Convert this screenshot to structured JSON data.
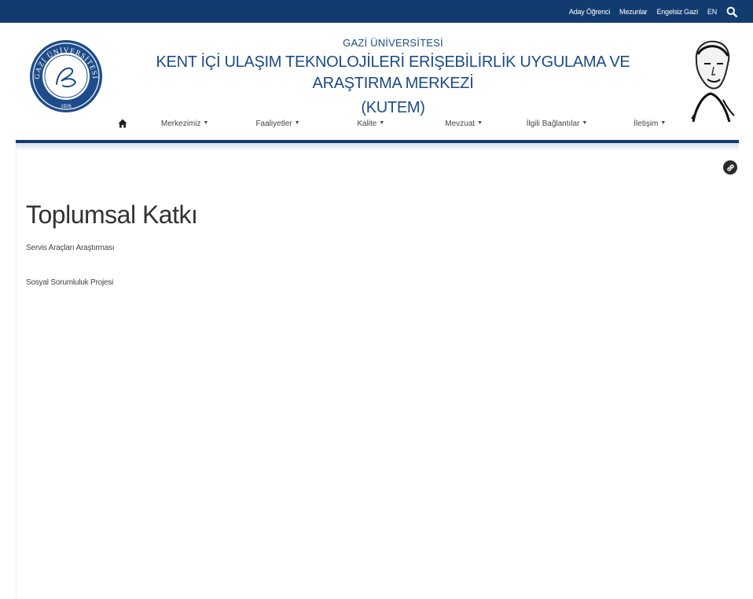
{
  "topbar": {
    "links": [
      "Aday Öğrenci",
      "Mezunlar",
      "Engelsiz Gazi",
      "EN"
    ],
    "background": "#123c70"
  },
  "header": {
    "university": "GAZİ ÜNİVERSİTESİ",
    "center_line1": "KENT İÇİ ULAŞIM TEKNOLOJİLERİ ERİŞEBİLİRLİK UYGULAMA VE ARAŞTIRMA MERKEZİ",
    "center_line2": "(KUTEM)",
    "logo_text": "GAZİ ÜNİVERSİTESİ",
    "logo_year": "1926",
    "title_color": "#1a4b86"
  },
  "nav": {
    "home_icon": "home-icon",
    "items": [
      "Merkezimiz",
      "Faaliyetler",
      "Kalite",
      "Mevzuat",
      "İlgili Bağlantılar",
      "İletişim"
    ]
  },
  "main": {
    "title": "Toplumsal Katkı",
    "links": [
      "Servis Araçları Araştırması",
      "Sosyal Sorumluluk Projesi"
    ]
  },
  "icons": {
    "search": "search-icon",
    "link": "link-icon"
  }
}
